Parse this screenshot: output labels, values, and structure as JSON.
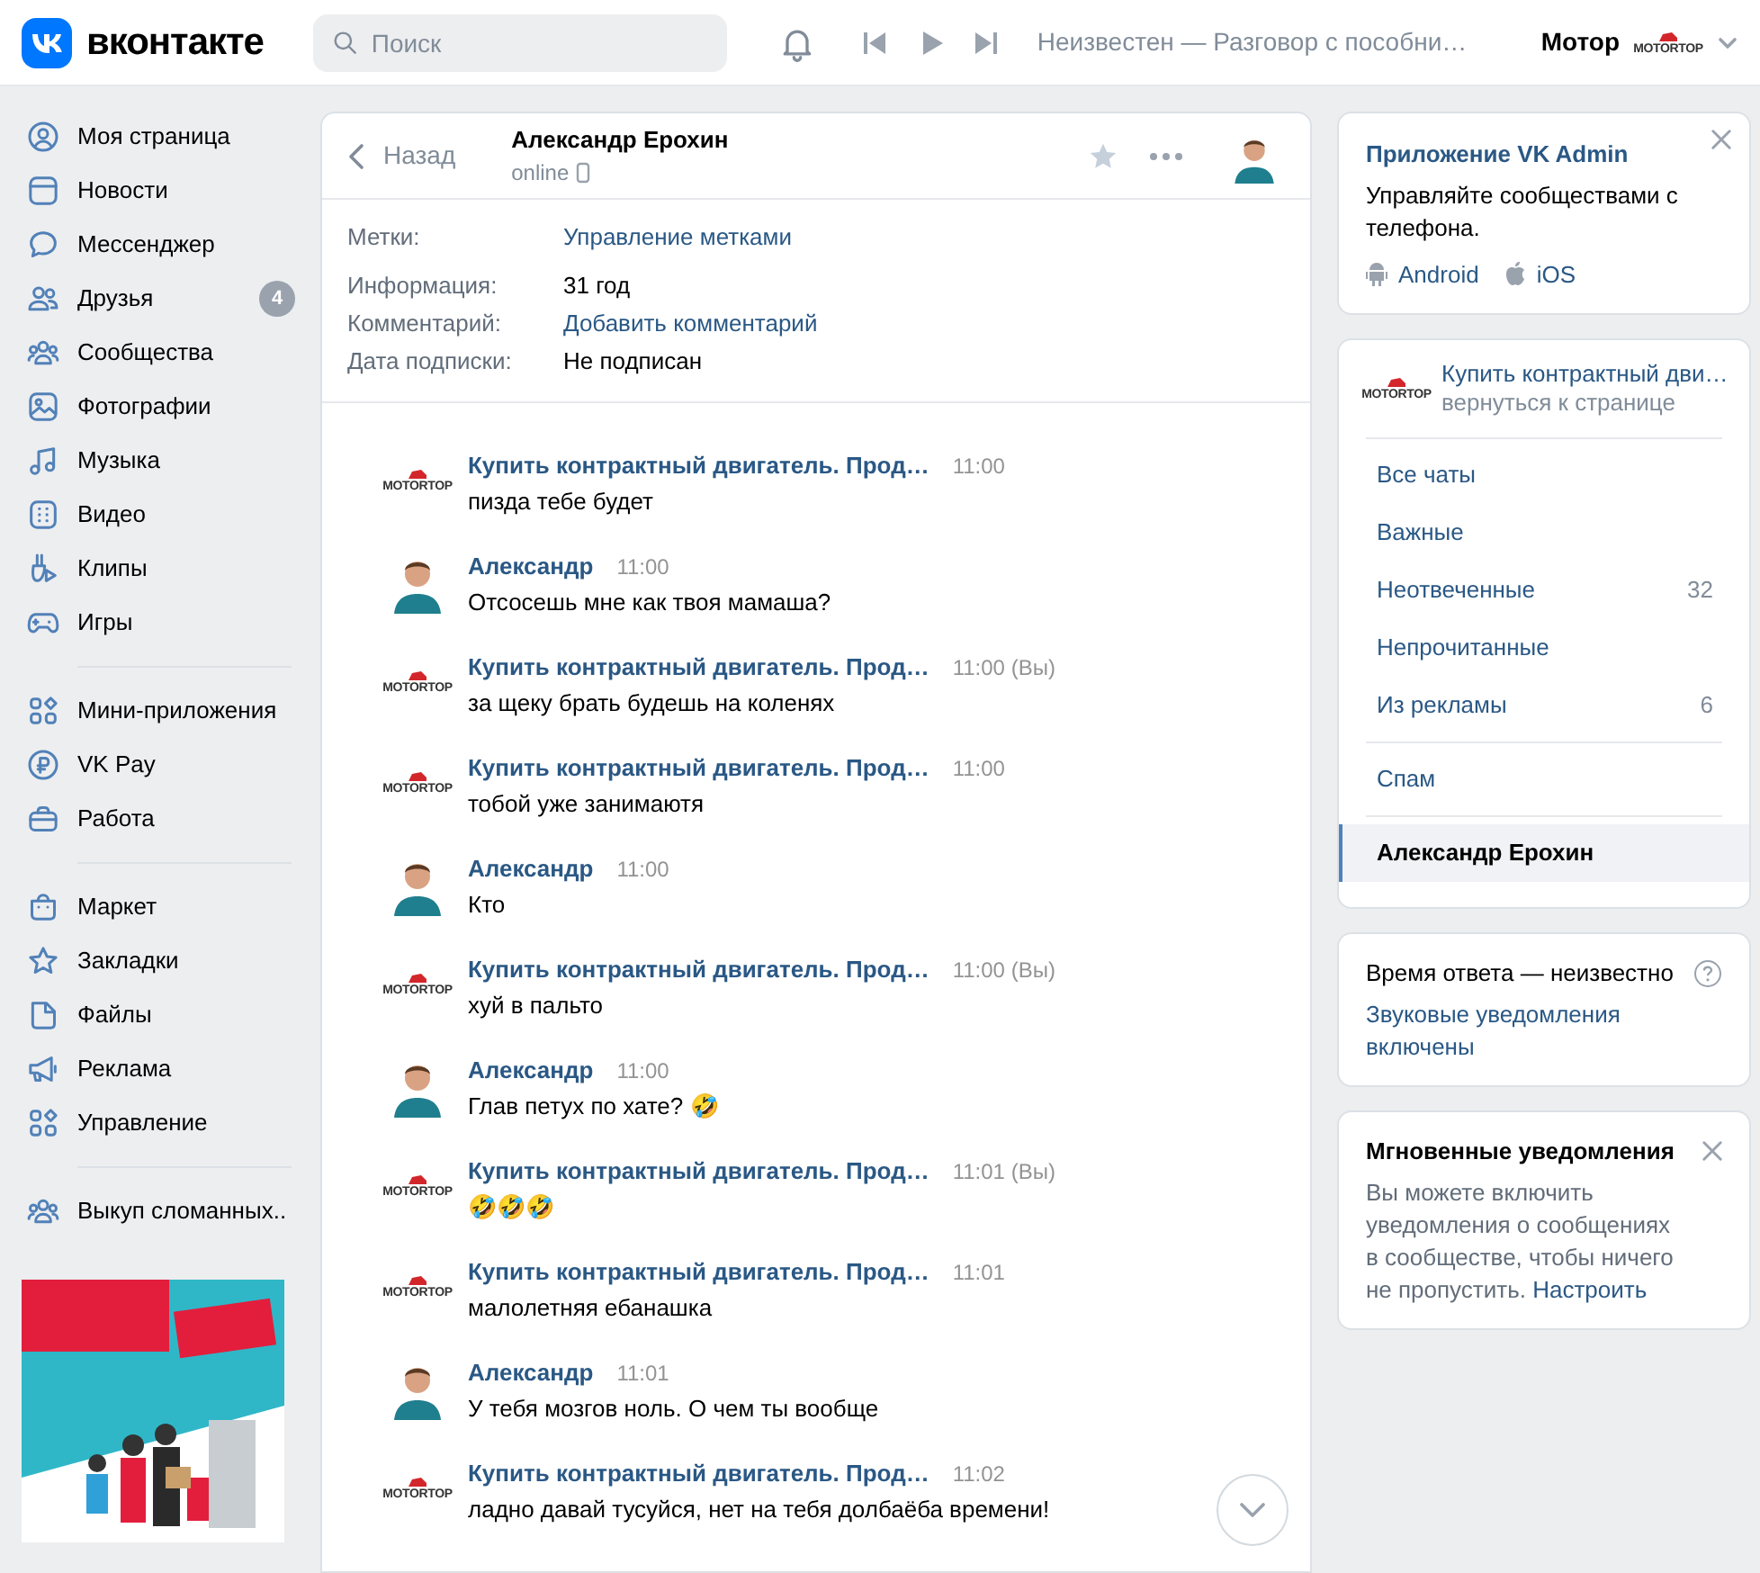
{
  "topbar": {
    "brand": "вконтакте",
    "search": {
      "placeholder": "Поиск"
    },
    "track": "Неизвестен — Разговор с пособни…",
    "user": {
      "name": "Мотор",
      "logo_text": "MOTORTOP"
    }
  },
  "sidebar": {
    "groups": [
      [
        {
          "label": "Моя страница"
        },
        {
          "label": "Новости"
        },
        {
          "label": "Мессенджер"
        },
        {
          "label": "Друзья",
          "badge": "4"
        },
        {
          "label": "Сообщества"
        },
        {
          "label": "Фотографии"
        },
        {
          "label": "Музыка"
        },
        {
          "label": "Видео"
        },
        {
          "label": "Клипы"
        },
        {
          "label": "Игры"
        }
      ],
      [
        {
          "label": "Мини-приложения"
        },
        {
          "label": "VK Pay"
        },
        {
          "label": "Работа"
        }
      ],
      [
        {
          "label": "Маркет"
        },
        {
          "label": "Закладки"
        },
        {
          "label": "Файлы"
        },
        {
          "label": "Реклама"
        },
        {
          "label": "Управление"
        }
      ],
      [
        {
          "label": "Выкуп сломанных.."
        }
      ]
    ]
  },
  "chat": {
    "header": {
      "back": "Назад",
      "name": "Александр Ерохин",
      "status": "online"
    },
    "info": [
      {
        "label": "Метки:",
        "value": "Управление метками",
        "kind": "link"
      },
      {
        "label": "Информация:",
        "value": "31 год",
        "kind": "text"
      },
      {
        "label": "Комментарий:",
        "value": "Добавить комментарий",
        "kind": "link"
      },
      {
        "label": "Дата подписки:",
        "value": "Не подписан",
        "kind": "text"
      }
    ],
    "messages": [
      {
        "kind": "group",
        "sender": "Купить контрактный двигатель. Прод…",
        "logo_text": "MOTORTOP",
        "time": "11:00",
        "text": "пизда тебе будет"
      },
      {
        "kind": "person",
        "sender": "Александр",
        "time": "11:00",
        "text": "Отсосешь мне как твоя мамаша?"
      },
      {
        "kind": "group",
        "sender": "Купить контрактный двигатель. Прод…",
        "logo_text": "MOTORTOP",
        "time": "11:00",
        "you": "(Вы)",
        "text": "за щеку брать будешь на коленях"
      },
      {
        "kind": "group",
        "sender": "Купить контрактный двигатель. Прод…",
        "logo_text": "MOTORTOP",
        "time": "11:00",
        "text": "тобой уже занимаютя"
      },
      {
        "kind": "person",
        "sender": "Александр",
        "time": "11:00",
        "text": "Кто"
      },
      {
        "kind": "group",
        "sender": "Купить контрактный двигатель. Прод…",
        "logo_text": "MOTORTOP",
        "time": "11:00",
        "you": "(Вы)",
        "text": "хуй в пальто"
      },
      {
        "kind": "person",
        "sender": "Александр",
        "time": "11:00",
        "text": "Глав петух по хате? 🤣"
      },
      {
        "kind": "group",
        "sender": "Купить контрактный двигатель. Прод…",
        "logo_text": "MOTORTOP",
        "time": "11:01",
        "you": "(Вы)",
        "text": "🤣🤣🤣"
      },
      {
        "kind": "group",
        "sender": "Купить контрактный двигатель. Прод…",
        "logo_text": "MOTORTOP",
        "time": "11:01",
        "text": "малолетняя ебанашка"
      },
      {
        "kind": "person",
        "sender": "Александр",
        "time": "11:01",
        "text": "У тебя мозгов ноль. О чем ты вообще"
      },
      {
        "kind": "group",
        "sender": "Купить контрактный двигатель. Прод…",
        "logo_text": "MOTORTOP",
        "time": "11:02",
        "text": "ладно давай тусуйся, нет на тебя долбаёба времени!"
      }
    ]
  },
  "right": {
    "app_card": {
      "title": "Приложение VK Admin",
      "text": "Управляйте сообществами с телефона.",
      "links": [
        "Android",
        "iOS"
      ]
    },
    "community": {
      "name": "Купить контрактный дви…",
      "logo_text": "MOTORTOP",
      "sub": "вернуться к странице",
      "groups": [
        [
          {
            "label": "Все чаты",
            "selected": false
          },
          {
            "label": "Важные",
            "selected": false
          },
          {
            "label": "Неотвеченные",
            "count": "32",
            "selected": false
          },
          {
            "label": "Непрочитанные",
            "selected": false
          },
          {
            "label": "Из рекламы",
            "count": "6",
            "selected": false
          }
        ],
        [
          {
            "label": "Спам",
            "selected": false
          }
        ],
        [
          {
            "label": "Александр Ерохин",
            "selected": true
          }
        ]
      ]
    },
    "response_card": {
      "text": "Время ответа — неизвестно",
      "link": "Звуковые уведомления включены"
    },
    "notify_card": {
      "title": "Мгновенные уведомления",
      "text": "Вы можете включить уведомления о сообщениях в сообществе, чтобы ничего не пропустить.",
      "link": "Настроить"
    }
  }
}
